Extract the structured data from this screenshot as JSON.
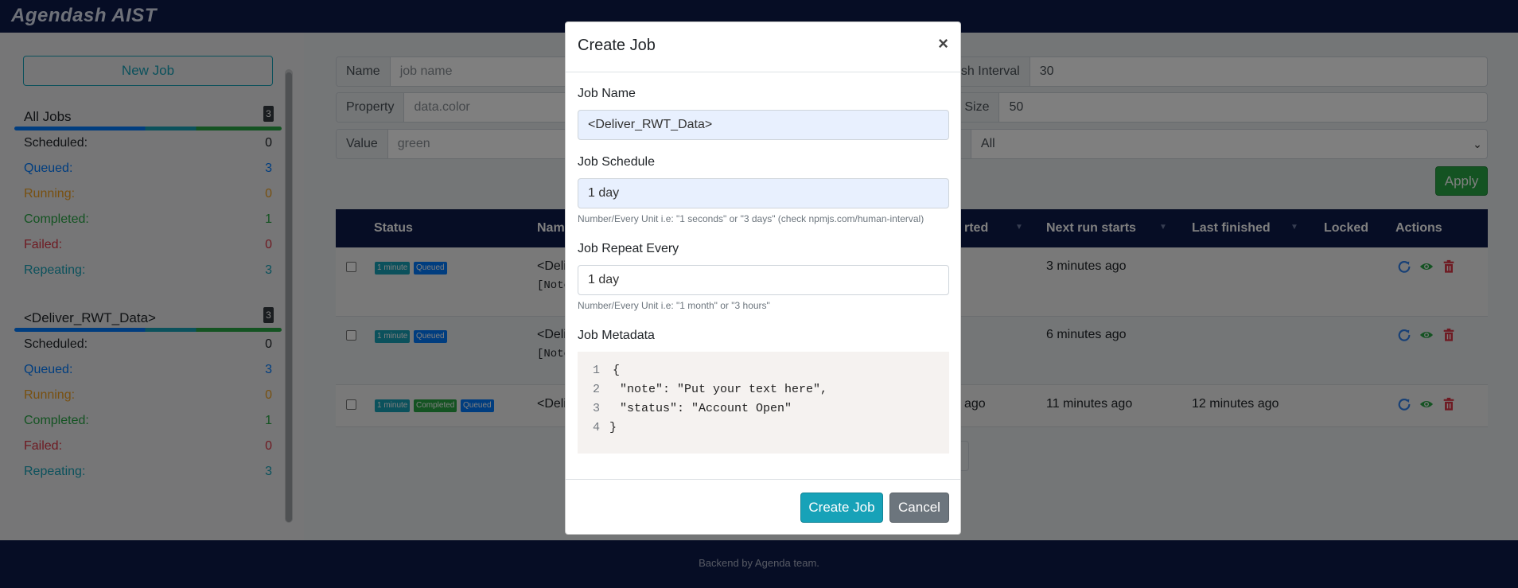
{
  "app": {
    "brand": "Agendash AIST"
  },
  "sidebar": {
    "new_job_label": "New Job",
    "groups": [
      {
        "title": "All Jobs",
        "badge": "3",
        "rows": [
          {
            "label": "Scheduled:",
            "count": "0"
          },
          {
            "label": "Queued:",
            "count": "3"
          },
          {
            "label": "Running:",
            "count": "0"
          },
          {
            "label": "Completed:",
            "count": "1"
          },
          {
            "label": "Failed:",
            "count": "0"
          },
          {
            "label": "Repeating:",
            "count": "3"
          }
        ]
      },
      {
        "title": "<Deliver_RWT_Data>",
        "badge": "3",
        "rows": [
          {
            "label": "Scheduled:",
            "count": "0"
          },
          {
            "label": "Queued:",
            "count": "3"
          },
          {
            "label": "Running:",
            "count": "0"
          },
          {
            "label": "Completed:",
            "count": "1"
          },
          {
            "label": "Failed:",
            "count": "0"
          },
          {
            "label": "Repeating:",
            "count": "3"
          }
        ]
      }
    ]
  },
  "filters": {
    "name_label": "Name",
    "name_placeholder": "job name",
    "property_label": "Property",
    "property_placeholder": "data.color",
    "value_label": "Value",
    "value_placeholder": "green",
    "refresh_label": "esh Interval",
    "refresh_value": "30",
    "pagesize_label": "e Size",
    "pagesize_value": "50",
    "state_label": "e",
    "state_value": "All",
    "apply_label": "Apply"
  },
  "table": {
    "headers": {
      "status": "Status",
      "name": "Nam",
      "started": "rted",
      "next_run": "Next run starts",
      "last_finished": "Last finished",
      "locked": "Locked",
      "actions": "Actions"
    },
    "rows": [
      {
        "tags": [
          "1 minute",
          "Queued"
        ],
        "name": "<Deli",
        "note": "[Note",
        "started": "",
        "next_run": "3 minutes ago",
        "last_finished": ""
      },
      {
        "tags": [
          "1 minute",
          "Queued"
        ],
        "name": "<Deli",
        "note": "[Note",
        "started": "",
        "next_run": "6 minutes ago",
        "last_finished": ""
      },
      {
        "tags": [
          "1 minute",
          "Completed",
          "Queued"
        ],
        "name": "<Deli",
        "note": "",
        "started": "ago",
        "next_run": "11 minutes ago",
        "last_finished": "12 minutes ago"
      }
    ]
  },
  "modal": {
    "title": "Create Job",
    "close": "×",
    "job_name_label": "Job Name",
    "job_name_value": "<Deliver_RWT_Data>",
    "job_schedule_label": "Job Schedule",
    "job_schedule_value": "1 day",
    "job_schedule_help": "Number/Every Unit i.e: \"1 seconds\" or \"3 days\" (check npmjs.com/human-interval)",
    "job_repeat_label": "Job Repeat Every",
    "job_repeat_value": "1 day",
    "job_repeat_help": "Number/Every Unit i.e: \"1 month\" or \"3 hours\"",
    "job_metadata_label": "Job Metadata",
    "code_lines": [
      {
        "n": "1",
        "text": "{"
      },
      {
        "n": "2",
        "text": " \"note\": \"Put your text here\","
      },
      {
        "n": "3",
        "text": " \"status\": \"Account Open\""
      },
      {
        "n": "4",
        "text": "}"
      }
    ],
    "create_label": "Create Job",
    "cancel_label": "Cancel"
  },
  "footer": {
    "text": "Backend by Agenda team."
  },
  "colors": {
    "navy": "#0c1a4b",
    "teal": "#17a2b8",
    "green": "#28a745",
    "blue": "#007bff",
    "red": "#dc3545",
    "gray": "#6c757d"
  }
}
